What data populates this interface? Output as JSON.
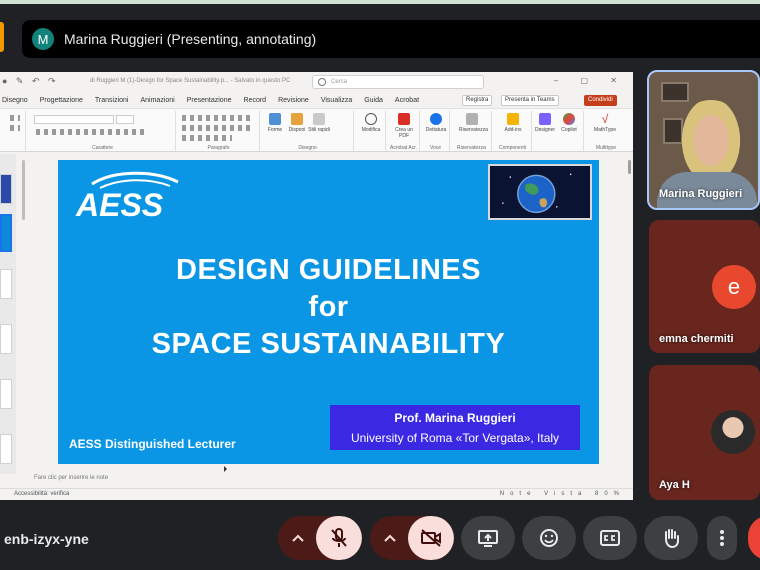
{
  "presenter": {
    "avatar_letter": "M",
    "title": "Marina Ruggieri (Presenting, annotating)"
  },
  "ppt": {
    "doc_title": "di Ruggieri M (1)-Design for Space Sustainability.p... - Salvato in questo PC",
    "search_placeholder": "Cerca",
    "menu": [
      "Disegno",
      "Progettazione",
      "Transizioni",
      "Animazioni",
      "Presentazione",
      "Record",
      "Revisione",
      "Visualizza",
      "Guida",
      "Acrobat"
    ],
    "buttons": {
      "record": "Registra",
      "present": "Presenta in Teams",
      "share": "Condividi"
    },
    "ribbon_groups": [
      "Carattere",
      "Paragrafo",
      "Disegno",
      "Acrobat Acr.",
      "Voce",
      "Riservatezza",
      "Componenti",
      "Multitype"
    ],
    "ribbon_tools": [
      "Forme",
      "Disponi",
      "Stili rapidi",
      "Modifica",
      "Crea un PDF",
      "Dettatura",
      "Riservatezza",
      "Add-ins",
      "Designer",
      "Copilot",
      "MathType"
    ],
    "notes_placeholder": "Fare clic per inserire le note",
    "status_left": "Accessibilità: verifica",
    "status_right": "Note  Vista  80%"
  },
  "slide": {
    "logo_text": "AESS",
    "title_line1": "DESIGN GUIDELINES",
    "title_line2": "for",
    "title_line3": "SPACE SUSTAINABILITY",
    "prof_name": "Prof. Marina Ruggieri",
    "prof_university": "University of Roma «Tor Vergata», Italy",
    "lecturer": "AESS Distinguished Lecturer"
  },
  "participants": [
    {
      "name": "Marina Ruggieri",
      "type": "video"
    },
    {
      "name": "emna chermiti",
      "type": "avatar",
      "letter": "e",
      "avatar_color": "#e8492e"
    },
    {
      "name": "Aya H",
      "type": "photo"
    }
  ],
  "meeting": {
    "code": "enb-izyx-yne"
  },
  "colors": {
    "slide_bg": "#0a96e4",
    "prof_box": "#3a28e3",
    "tile_bg": "#68261f",
    "control_red": "#f9dedc",
    "share_button": "#c43e1c"
  }
}
